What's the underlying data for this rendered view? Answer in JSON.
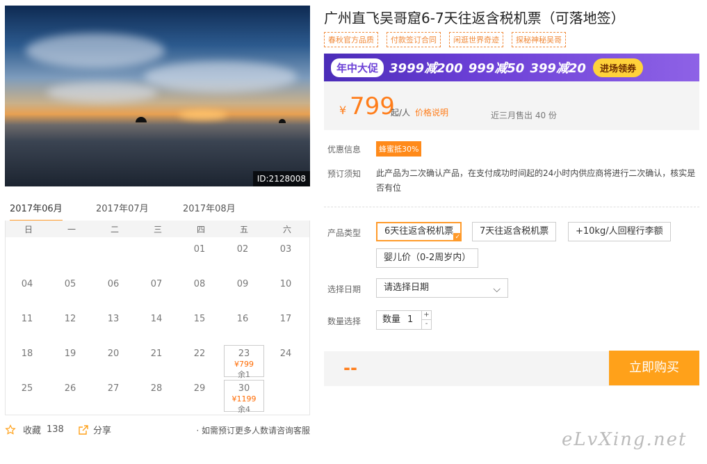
{
  "photo": {
    "id_label": "ID:2128008"
  },
  "product": {
    "title": "广州直飞吴哥窟6-7天往返含税机票（可落地签）",
    "tags": [
      "春秋官方品质",
      "付款签订合同",
      "闲逛世界奇迹",
      "探秘神秘吴哥"
    ]
  },
  "banner": {
    "label": "年中大促",
    "deals": [
      "3999减200",
      "999减50",
      "399减20"
    ],
    "cta": "进场领券"
  },
  "price": {
    "currency": "¥",
    "value": "799",
    "unit": "起/人",
    "desc_link": "价格说明",
    "sold": "近三月售出 40 份"
  },
  "offers": {
    "label": "优惠信息",
    "badge": "蜂蜜抵30%"
  },
  "booking_notice": {
    "label": "预订须知",
    "text": "此产品为二次确认产品，在支付成功时间起的24小时内供应商将进行二次确认，核实是否有位"
  },
  "product_type": {
    "label": "产品类型",
    "options": [
      "6天往返含税机票",
      "7天往返含税机票",
      "+10kg/人回程行李额",
      "婴儿价（0-2周岁内）"
    ],
    "selected": "6天往返含税机票"
  },
  "date_select": {
    "label": "选择日期",
    "placeholder": "请选择日期"
  },
  "quantity": {
    "label": "数量选择",
    "prefix": "数量",
    "value": "1",
    "plus": "+",
    "minus": "-"
  },
  "buy": {
    "total": "--",
    "button": "立即购买"
  },
  "calendar": {
    "months": [
      "2017年06月",
      "2017年07月",
      "2017年08月"
    ],
    "active_month": "2017年06月",
    "weekdays": [
      "日",
      "一",
      "二",
      "三",
      "四",
      "五",
      "六"
    ],
    "days": [
      [
        "",
        "",
        "",
        "",
        "01",
        "02",
        "03"
      ],
      [
        "04",
        "05",
        "06",
        "07",
        "08",
        "09",
        "10"
      ],
      [
        "11",
        "12",
        "13",
        "14",
        "15",
        "16",
        "17"
      ],
      [
        "18",
        "19",
        "20",
        "21",
        "22",
        "23",
        "24"
      ],
      [
        "25",
        "26",
        "27",
        "28",
        "29",
        "30",
        ""
      ]
    ],
    "available": [
      {
        "day": "23",
        "price": "¥799",
        "remain": "余1"
      },
      {
        "day": "30",
        "price": "¥1199",
        "remain": "余4"
      }
    ]
  },
  "footer": {
    "favorite_label": "收藏",
    "favorite_count": "138",
    "share_label": "分享",
    "consult": "· 如需预订更多人数请咨询客服"
  },
  "watermark": "eLvXing.net",
  "colors": {
    "accent": "#ff7d1a",
    "button": "#ffa11a",
    "banner": "#6b3fd6"
  }
}
